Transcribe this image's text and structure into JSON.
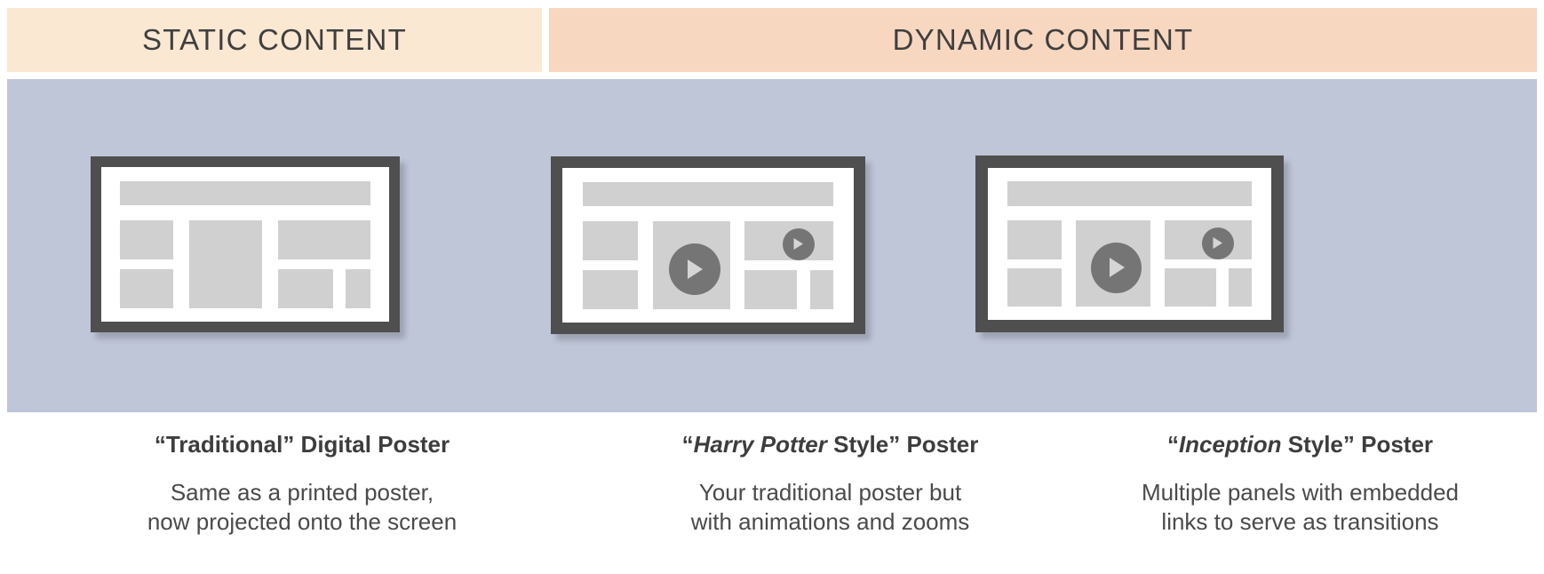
{
  "header": {
    "sections": [
      {
        "id": "static",
        "label": "STATIC CONTENT",
        "bg": "#fbe8d2"
      },
      {
        "id": "dynamic",
        "label": "DYNAMIC CONTENT",
        "bg": "#f8d7c0"
      }
    ]
  },
  "stage": {
    "background": "#bfc6d8",
    "monitor_frame_color": "#4f4f4f",
    "screen_color": "#ffffff",
    "block_color": "#d0d0d0",
    "sheet_block_color": "#e5e5e5",
    "play_badge_color": "#757575",
    "stand_color": "#555555"
  },
  "columns": [
    {
      "id": "traditional",
      "title_parts": [
        {
          "text": "“Traditional” Digital Poster",
          "italic": false
        }
      ],
      "title_plain": "“Traditional” Digital Poster",
      "body_line1": "Same as a printed poster,",
      "body_line2": "now projected onto the screen",
      "has_play_buttons": false,
      "has_stacked_panels": false,
      "play_button_count": 0
    },
    {
      "id": "harry-potter",
      "title_parts": [
        {
          "text": "“",
          "italic": false
        },
        {
          "text": "Harry Potter",
          "italic": true
        },
        {
          "text": " Style” Poster",
          "italic": false
        }
      ],
      "title_plain": "“Harry Potter Style” Poster",
      "body_line1": "Your traditional poster but",
      "body_line2": "with animations and zooms",
      "has_play_buttons": true,
      "has_stacked_panels": false,
      "play_button_count": 2
    },
    {
      "id": "inception",
      "title_parts": [
        {
          "text": "“",
          "italic": false
        },
        {
          "text": "Inception",
          "italic": true
        },
        {
          "text": " Style” Poster",
          "italic": false
        }
      ],
      "title_plain": "“Inception Style” Poster",
      "body_line1": "Multiple panels with embedded",
      "body_line2": "links to serve as transitions",
      "has_play_buttons": true,
      "has_stacked_panels": true,
      "play_button_count": 2
    }
  ]
}
